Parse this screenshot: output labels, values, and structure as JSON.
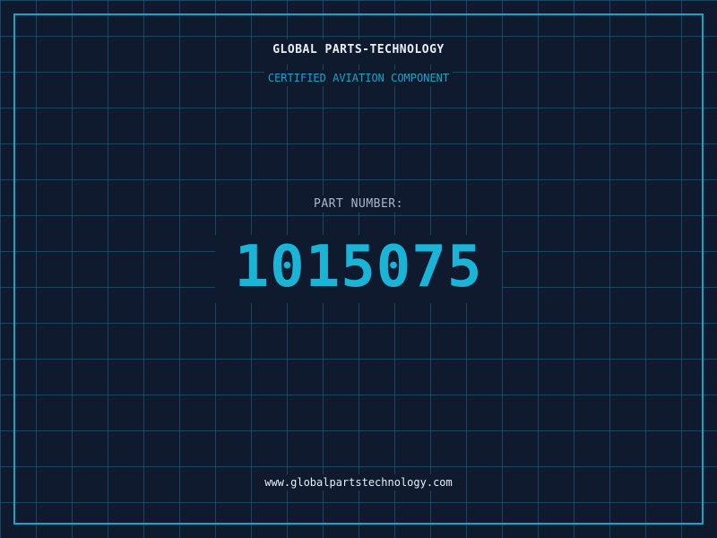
{
  "header": {
    "company": "GLOBAL PARTS-TECHNOLOGY",
    "tagline": "CERTIFIED AVIATION COMPONENT"
  },
  "part": {
    "label": "PART NUMBER:",
    "number": "1015075"
  },
  "footer": {
    "website": "www.globalpartstechnology.com"
  },
  "colors": {
    "background": "#0f1a2e",
    "grid": "#1c6e8c",
    "accent": "#1aa3c9",
    "part_number": "#19b4d6",
    "text": "#e8eef5",
    "label": "#a9b8c8"
  }
}
